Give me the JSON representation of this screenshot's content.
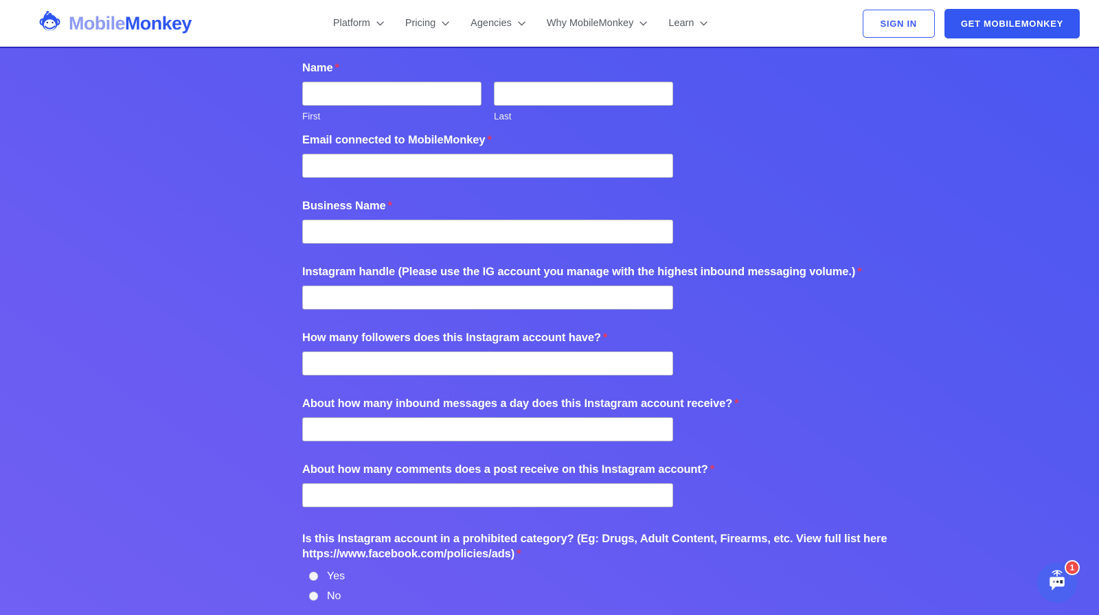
{
  "header": {
    "logo": {
      "icon": "monkey-logo-icon",
      "text_light": "Mobile",
      "text_bold": "Monkey"
    },
    "nav_items": [
      {
        "label": "Platform",
        "has_dropdown": true
      },
      {
        "label": "Pricing",
        "has_dropdown": true
      },
      {
        "label": "Agencies",
        "has_dropdown": true
      },
      {
        "label": "Why MobileMonkey",
        "has_dropdown": true
      },
      {
        "label": "Learn",
        "has_dropdown": true
      }
    ],
    "sign_in_label": "SIGN IN",
    "get_started_label": "GET MOBILEMONKEY"
  },
  "form": {
    "name_field": {
      "label": "Name",
      "required_mark": "*",
      "first_sublabel": "First",
      "last_sublabel": "Last",
      "first_value": "",
      "last_value": ""
    },
    "fields": [
      {
        "label": "Email connected to MobileMonkey",
        "required_mark": "*",
        "value": ""
      },
      {
        "label": "Business Name",
        "required_mark": "*",
        "value": ""
      },
      {
        "label": "Instagram handle (Please use the IG account you manage with the highest inbound messaging volume.)",
        "required_mark": "*",
        "value": ""
      },
      {
        "label": "How many followers does this Instagram account have?",
        "required_mark": "*",
        "value": ""
      },
      {
        "label": "About how many inbound messages a day does this Instagram account receive?",
        "required_mark": "*",
        "value": ""
      },
      {
        "label": "About how many comments does a post receive on this Instagram account?",
        "required_mark": "*",
        "value": ""
      }
    ],
    "radio_question": {
      "label": "Is this Instagram account in a prohibited category? (Eg: Drugs, Adult Content, Firearms, etc. View full list here https://www.facebook.com/policies/ads)",
      "required_mark": "*",
      "options": [
        {
          "label": "Yes",
          "selected": false
        },
        {
          "label": "No",
          "selected": false
        }
      ]
    }
  },
  "chat_widget": {
    "icon": "chat-bubble-antenna-icon",
    "badge_count": "1"
  },
  "colors": {
    "background_start": "#4a57f2",
    "background_end": "#7060f3",
    "accent_blue": "#3357f0",
    "required_red": "#e8375a",
    "badge_red": "#f04a4a",
    "logo_light": "#8f9bf4",
    "logo_bold": "#2e54f0"
  }
}
